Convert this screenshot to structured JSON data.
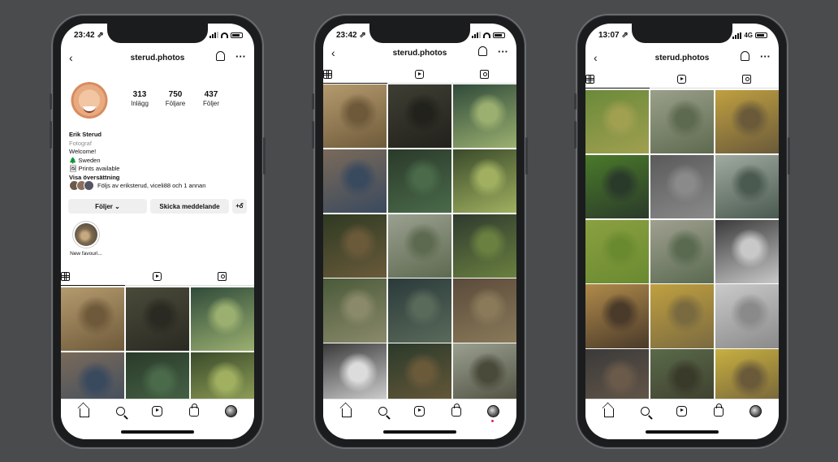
{
  "phones": [
    {
      "status": {
        "time": "23:42 ⇗"
      },
      "header": {
        "username": "sterud.photos"
      },
      "profile": {
        "stats": [
          {
            "value": "313",
            "label": "Inlägg"
          },
          {
            "value": "750",
            "label": "Följare"
          },
          {
            "value": "437",
            "label": "Följer"
          }
        ],
        "name": "Erik Sterud",
        "category": "Fotograf",
        "bio_lines": [
          "Welcome!",
          "🌲 Sweden",
          "🖼 Prints available"
        ],
        "translate_link": "Visa översättning",
        "followed_by": "Följs av eriksterud, viceli88 och 1 annan",
        "follow_button": "Följer ⌄",
        "message_button": "Skicka meddelande",
        "add_person_button": "+Ꮄ",
        "highlight_label": "New favouri..."
      }
    },
    {
      "status": {
        "time": "23:42 ⇗"
      },
      "header": {
        "username": "sterud.photos"
      }
    },
    {
      "status": {
        "time": "13:07 ⇗",
        "network": "4G"
      },
      "header": {
        "username": "sterud.photos"
      }
    }
  ],
  "icons": {
    "back": "back-chevron-icon",
    "bell": "bell-icon",
    "more": "more-icon",
    "grid_tab": "grid-icon",
    "reels_tab": "reels-icon",
    "tagged_tab": "tagged-icon",
    "home": "home-icon",
    "search": "search-icon",
    "reels": "reels-icon",
    "shop": "shop-icon",
    "profile": "avatar-icon"
  },
  "colors": {
    "background": "#4a4b4d",
    "accent_red": "#e0245e"
  }
}
